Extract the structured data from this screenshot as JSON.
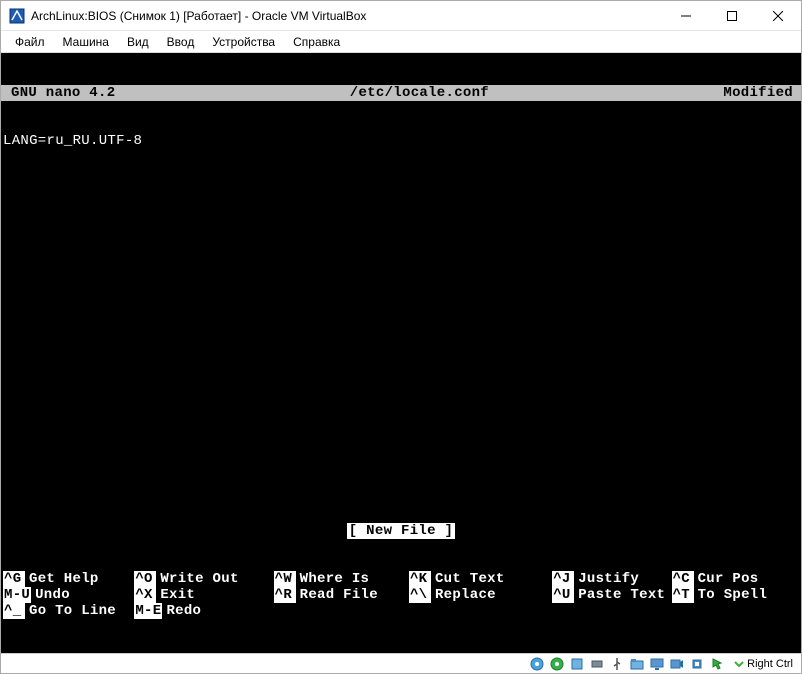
{
  "window": {
    "title": "ArchLinux:BIOS (Снимок 1) [Работает] - Oracle VM VirtualBox"
  },
  "menu": {
    "items": [
      "Файл",
      "Машина",
      "Вид",
      "Ввод",
      "Устройства",
      "Справка"
    ]
  },
  "nano": {
    "header_left": "GNU nano 4.2",
    "header_center": "/etc/locale.conf",
    "header_right": "Modified",
    "content_line": "LANG=ru_RU.UTF-8",
    "newfile_label": "[ New File ]",
    "commands": [
      {
        "key": "^G",
        "label": "Get Help"
      },
      {
        "key": "^O",
        "label": "Write Out"
      },
      {
        "key": "^W",
        "label": "Where Is"
      },
      {
        "key": "^K",
        "label": "Cut Text"
      },
      {
        "key": "^J",
        "label": "Justify"
      },
      {
        "key": "^C",
        "label": "Cur Pos"
      },
      {
        "key": "M-U",
        "label": "Undo"
      },
      {
        "key": "^X",
        "label": "Exit"
      },
      {
        "key": "^R",
        "label": "Read File"
      },
      {
        "key": "^\\",
        "label": "Replace"
      },
      {
        "key": "^U",
        "label": "Paste Text"
      },
      {
        "key": "^T",
        "label": "To Spell"
      },
      {
        "key": "^_",
        "label": "Go To Line"
      },
      {
        "key": "M-E",
        "label": "Redo"
      }
    ]
  },
  "statusbar": {
    "host_key": "Right Ctrl"
  }
}
